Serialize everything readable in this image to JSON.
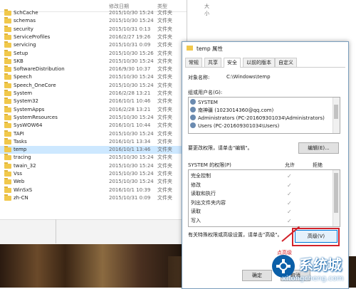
{
  "columns": {
    "date": "修改日期",
    "type": "类型",
    "size": "大小"
  },
  "files": [
    {
      "name": "SchCache",
      "date": "2015/10/30 15:24",
      "type": "文件夹"
    },
    {
      "name": "schemas",
      "date": "2015/10/30 15:24",
      "type": "文件夹"
    },
    {
      "name": "security",
      "date": "2015/10/31 0:13",
      "type": "文件夹"
    },
    {
      "name": "ServiceProfiles",
      "date": "2016/2/27 19:26",
      "type": "文件夹"
    },
    {
      "name": "servicing",
      "date": "2015/10/31 0:09",
      "type": "文件夹"
    },
    {
      "name": "Setup",
      "date": "2015/10/30 15:26",
      "type": "文件夹"
    },
    {
      "name": "SKB",
      "date": "2015/10/30 15:24",
      "type": "文件夹"
    },
    {
      "name": "SoftwareDistribution",
      "date": "2016/9/30 10:37",
      "type": "文件夹"
    },
    {
      "name": "Speech",
      "date": "2015/10/30 15:24",
      "type": "文件夹"
    },
    {
      "name": "Speech_OneCore",
      "date": "2015/10/30 15:24",
      "type": "文件夹"
    },
    {
      "name": "System",
      "date": "2016/2/28 13:21",
      "type": "文件夹"
    },
    {
      "name": "System32",
      "date": "2016/10/1 10:46",
      "type": "文件夹"
    },
    {
      "name": "SystemApps",
      "date": "2016/2/28 13:21",
      "type": "文件夹"
    },
    {
      "name": "SystemResources",
      "date": "2015/10/30 15:24",
      "type": "文件夹"
    },
    {
      "name": "SysWOW64",
      "date": "2016/10/1 10:44",
      "type": "文件夹"
    },
    {
      "name": "TAPI",
      "date": "2015/10/30 15:24",
      "type": "文件夹"
    },
    {
      "name": "Tasks",
      "date": "2016/10/1 13:34",
      "type": "文件夹"
    },
    {
      "name": "temp",
      "date": "2016/10/1 13:46",
      "type": "文件夹",
      "selected": true
    },
    {
      "name": "tracing",
      "date": "2015/10/30 15:24",
      "type": "文件夹"
    },
    {
      "name": "twain_32",
      "date": "2015/10/30 15:24",
      "type": "文件夹"
    },
    {
      "name": "Vss",
      "date": "2015/10/30 15:24",
      "type": "文件夹"
    },
    {
      "name": "Web",
      "date": "2015/10/30 15:24",
      "type": "文件夹"
    },
    {
      "name": "WinSxS",
      "date": "2016/10/1 10:39",
      "type": "文件夹"
    },
    {
      "name": "zh-CN",
      "date": "2015/10/31 0:09",
      "type": "文件夹"
    }
  ],
  "dialog": {
    "title": "temp 属性",
    "tabs": [
      "常规",
      "共享",
      "安全",
      "以前的版本",
      "自定义"
    ],
    "active_tab": 2,
    "object_label": "对象名称:",
    "object_value": "C:\\Windows\\temp",
    "group_label": "组或用户名(G):",
    "users": [
      "SYSTEM",
      "南神疆 (1023014360@qq.com)",
      "Administrators (PC-201609301034\\Administrators)",
      "Users (PC-201609301034\\Users)"
    ],
    "change_perm_text": "要更改权限，请单击\"编辑\"。",
    "edit_button": "编辑(E)...",
    "perm_header": "SYSTEM 的权限(P)",
    "allow": "允许",
    "deny": "拒绝",
    "permissions": [
      "完全控制",
      "修改",
      "读取和执行",
      "列出文件夹内容",
      "读取",
      "写入"
    ],
    "special_text": "有关特殊权限或高级设置，请单击\"高级\"。",
    "advanced_button": "高级(V)",
    "ok_button": "确定",
    "cancel_button": "取消"
  },
  "annotation": "点高级",
  "watermark": {
    "brand": "系统城",
    "url": "xitongcheng.com",
    "color": "#0b5fa8"
  }
}
